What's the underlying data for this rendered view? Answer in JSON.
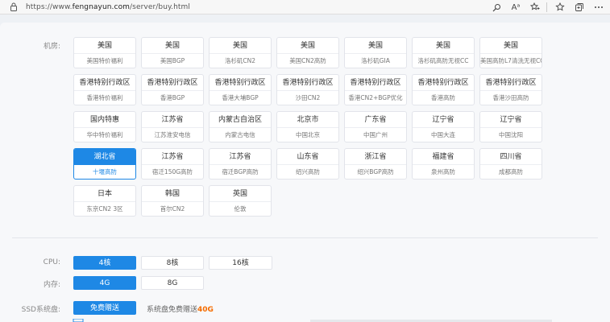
{
  "browser": {
    "url_prefix": "https://www.",
    "url_host": "fengnayun.com",
    "url_path": "/server/buy.html",
    "icons": [
      "lock-icon",
      "search-icon",
      "read-aloud-icon",
      "favorite-icon",
      "favorites-bar-icon",
      "collections-icon",
      "more-icon"
    ],
    "read_aloud_glyph": "Aᵃ"
  },
  "datacenter": {
    "label": "机房:",
    "rows": [
      [
        {
          "title": "美国",
          "sub": "美国特价福利"
        },
        {
          "title": "美国",
          "sub": "美国BGP"
        },
        {
          "title": "美国",
          "sub": "洛杉矶CN2"
        },
        {
          "title": "美国",
          "sub": "美国CN2高防"
        },
        {
          "title": "美国",
          "sub": "洛杉矶GIA"
        },
        {
          "title": "美国",
          "sub": "洛杉矶高防无视CC"
        },
        {
          "title": "美国",
          "sub": "美国高防L7清洗无视CC"
        }
      ],
      [
        {
          "title": "香港特别行政区",
          "sub": "香港特价福利"
        },
        {
          "title": "香港特别行政区",
          "sub": "香港BGP"
        },
        {
          "title": "香港特别行政区",
          "sub": "香港大埔BGP"
        },
        {
          "title": "香港特别行政区",
          "sub": "沙田CN2"
        },
        {
          "title": "香港特别行政区",
          "sub": "香港CN2+BGP优化"
        },
        {
          "title": "香港特别行政区",
          "sub": "香港高防"
        },
        {
          "title": "香港特别行政区",
          "sub": "香港沙田高防"
        }
      ],
      [
        {
          "title": "国内特惠",
          "sub": "华中特价福利"
        },
        {
          "title": "江苏省",
          "sub": "江苏淮安电信"
        },
        {
          "title": "内蒙古自治区",
          "sub": "内蒙古电信"
        },
        {
          "title": "北京市",
          "sub": "中国北京"
        },
        {
          "title": "广东省",
          "sub": "中国广州"
        },
        {
          "title": "辽宁省",
          "sub": "中国大连"
        },
        {
          "title": "辽宁省",
          "sub": "中国沈阳"
        }
      ],
      [
        {
          "title": "湖北省",
          "sub": "十堰高防",
          "selected": true
        },
        {
          "title": "江苏省",
          "sub": "宿迁150G高防"
        },
        {
          "title": "江苏省",
          "sub": "宿迁BGP高防"
        },
        {
          "title": "山东省",
          "sub": "绍兴高防"
        },
        {
          "title": "浙江省",
          "sub": "绍兴BGP高防"
        },
        {
          "title": "福建省",
          "sub": "泉州高防"
        },
        {
          "title": "四川省",
          "sub": "成都高防"
        }
      ],
      [
        {
          "title": "日本",
          "sub": "东京CN2 3区"
        },
        {
          "title": "韩国",
          "sub": "首尔CN2"
        },
        {
          "title": "英国",
          "sub": "伦敦"
        }
      ]
    ]
  },
  "cpu": {
    "label": "CPU:",
    "options": [
      {
        "label": "4核",
        "selected": true
      },
      {
        "label": "8核"
      },
      {
        "label": "16核"
      }
    ]
  },
  "memory": {
    "label": "内存:",
    "options": [
      {
        "label": "4G",
        "selected": true
      },
      {
        "label": "8G"
      }
    ]
  },
  "ssd": {
    "label": "SSD系统盘:",
    "button": "免费赠送",
    "note_prefix": "系统盘免费赠送",
    "note_amount": "40G"
  },
  "colors": {
    "accent": "#1e88e5",
    "highlight": "#f56c00"
  }
}
